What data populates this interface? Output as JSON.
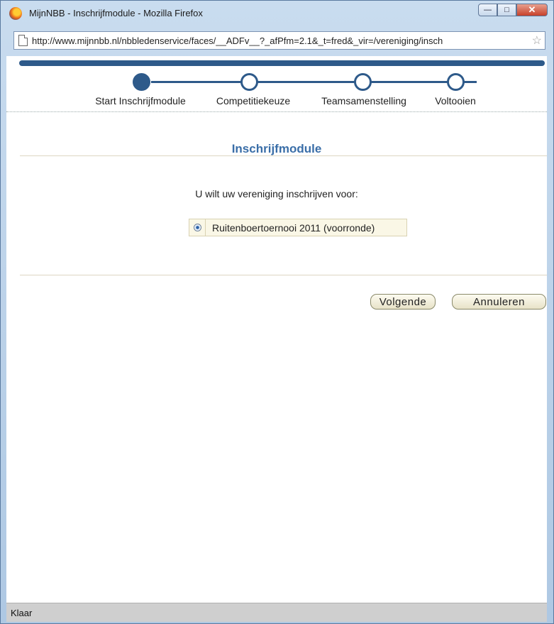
{
  "window": {
    "title": "MijnNBB - Inschrijfmodule - Mozilla Firefox",
    "app_icon": "firefox-icon",
    "buttons": {
      "minimize": "minimize-icon",
      "maximize": "maximize-icon",
      "close": "close-icon"
    }
  },
  "address_bar": {
    "url": "http://www.mijnnbb.nl/nbbledenservice/faces/__ADFv__?_afPfm=2.1&_t=fred&_vir=/vereniging/insch",
    "page_icon": "page-icon",
    "bookmark_icon": "star-icon"
  },
  "train": {
    "steps": [
      {
        "label": "Start Inschrijfmodule",
        "state": "current"
      },
      {
        "label": "Competitiekeuze",
        "state": "upcoming"
      },
      {
        "label": "Teamsamenstelling",
        "state": "upcoming"
      },
      {
        "label": "Voltooien",
        "state": "upcoming"
      }
    ],
    "color": "#2e5a8a"
  },
  "main": {
    "heading": "Inschrijfmodule",
    "prompt": "U wilt uw vereniging inschrijven voor:",
    "option": {
      "label": "Ruitenboertoernooi 2011 (voorronde)",
      "selected": true
    }
  },
  "actions": {
    "next_label": "Volgende",
    "cancel_label": "Annuleren"
  },
  "status": {
    "text": "Klaar"
  },
  "colors": {
    "accent": "#2e5a8a",
    "heading": "#3a6ea8"
  }
}
